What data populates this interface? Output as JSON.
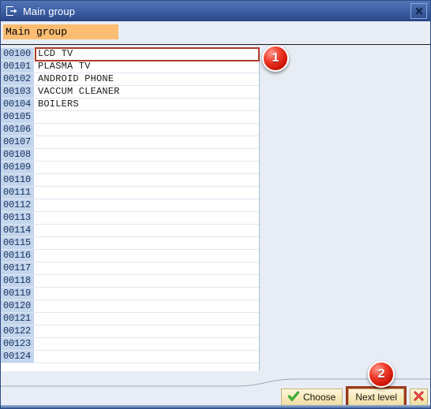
{
  "window": {
    "title": "Main group",
    "icon": "dialog-window-icon",
    "close_label": "Close",
    "close_icon": "close-icon"
  },
  "field": {
    "name": "main-group",
    "value": "Main group",
    "placeholder": "Main group"
  },
  "list": {
    "selected_index": 0,
    "rows": [
      {
        "num": "00100",
        "value": "LCD TV"
      },
      {
        "num": "00101",
        "value": "PLASMA TV"
      },
      {
        "num": "00102",
        "value": "ANDROID PHONE"
      },
      {
        "num": "00103",
        "value": "VACCUM CLEANER"
      },
      {
        "num": "00104",
        "value": "BOILERS"
      },
      {
        "num": "00105",
        "value": ""
      },
      {
        "num": "00106",
        "value": ""
      },
      {
        "num": "00107",
        "value": ""
      },
      {
        "num": "00108",
        "value": ""
      },
      {
        "num": "00109",
        "value": ""
      },
      {
        "num": "00110",
        "value": ""
      },
      {
        "num": "00111",
        "value": ""
      },
      {
        "num": "00112",
        "value": ""
      },
      {
        "num": "00113",
        "value": ""
      },
      {
        "num": "00114",
        "value": ""
      },
      {
        "num": "00115",
        "value": ""
      },
      {
        "num": "00116",
        "value": ""
      },
      {
        "num": "00117",
        "value": ""
      },
      {
        "num": "00118",
        "value": ""
      },
      {
        "num": "00119",
        "value": ""
      },
      {
        "num": "00120",
        "value": ""
      },
      {
        "num": "00121",
        "value": ""
      },
      {
        "num": "00122",
        "value": ""
      },
      {
        "num": "00123",
        "value": ""
      },
      {
        "num": "00124",
        "value": ""
      }
    ]
  },
  "footer": {
    "choose_label": "Choose",
    "choose_icon": "green-check-icon",
    "next_level_label": "Next level",
    "cancel_icon": "red-x-icon",
    "cancel_label": "Cancel"
  },
  "annotations": {
    "badge_1": "1",
    "badge_2": "2",
    "highlight_color": "#b03a28",
    "button_highlight_color": "#9c3a1e"
  },
  "colors": {
    "titlebar_top": "#5375b6",
    "titlebar_bottom": "#28417e",
    "dialog_background": "#e8edf5",
    "field_background": "#fbbd72",
    "row_number_background": "#c3d5ec",
    "button_background": "#f6e8b8"
  }
}
